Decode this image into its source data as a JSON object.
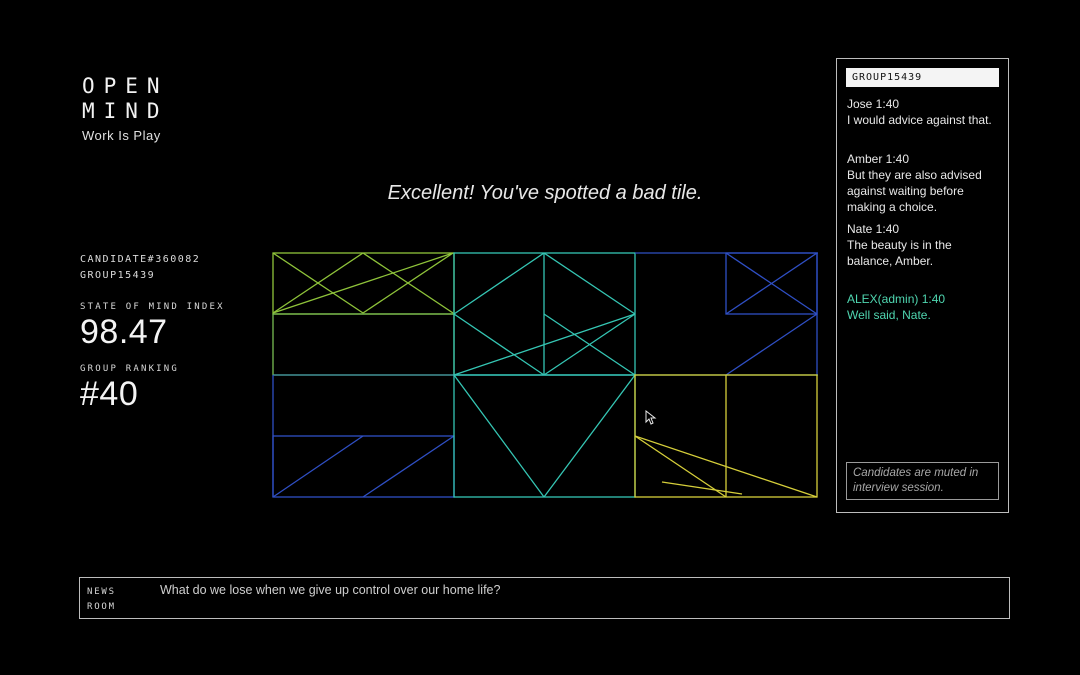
{
  "brand": {
    "line1": "OPEN",
    "line2": "MIND",
    "tagline": "Work Is Play"
  },
  "stats": {
    "candidate": "CANDIDATE#360082",
    "group": "GROUP15439",
    "state_label": "STATE OF MIND INDEX",
    "state_value": "98.47",
    "ranking_label": "GROUP RANKING",
    "ranking_value": "#40"
  },
  "message": "Excellent! You've spotted a bad tile.",
  "chat": {
    "group": "GROUP15439",
    "messages": [
      {
        "author": "Jose 1:40",
        "text": "I would advice against that.",
        "admin": false
      },
      {
        "author": "Amber 1:40",
        "text": "But they are also advised against waiting before making a choice.",
        "admin": false
      },
      {
        "author": "Nate 1:40",
        "text": "The beauty is in the balance, Amber.",
        "admin": false
      },
      {
        "author": "ALEX(admin) 1:40",
        "text": "Well said, Nate.",
        "admin": true
      }
    ],
    "muted_notice": "Candidates are muted in interview session."
  },
  "news": {
    "label_line1": "NEWS",
    "label_line2": "ROOM",
    "headline": "What do we lose when we give up control over our home life?"
  },
  "board": {
    "grid": {
      "columns": 6,
      "rows": 4
    },
    "colors": {
      "green": "#8fc43a",
      "teal": "#35c6b4",
      "blue": "#2f4fc4",
      "yellow": "#d6cf3a",
      "cyan": "#3fb6c8"
    },
    "cursor_icon": "arrow-cursor-icon"
  }
}
